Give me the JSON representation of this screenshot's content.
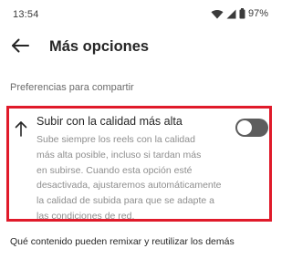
{
  "status_bar": {
    "time": "13:54",
    "battery_percent": "97%",
    "icons": [
      "wifi-icon",
      "signal-icon",
      "battery-icon"
    ]
  },
  "header": {
    "back_icon": "arrow-left-icon",
    "title": "Más opciones"
  },
  "section": {
    "title": "Preferencias para compartir"
  },
  "high_quality_option": {
    "icon": "upload-arrow-icon",
    "title": "Subir con la calidad más alta",
    "description_lines": [
      "Sube siempre los reels con la calidad",
      "más alta posible, incluso si tardan más",
      "en subirse. Cuando esta opción esté",
      "desactivada, ajustaremos automáticamente",
      "la calidad de subida para que se adapte a",
      "las condiciones de red."
    ],
    "toggle_on": false,
    "highlight_color": "#e01a2a"
  },
  "remix_item": {
    "label": "Qué contenido pueden remixar y reutilizar los demás"
  }
}
